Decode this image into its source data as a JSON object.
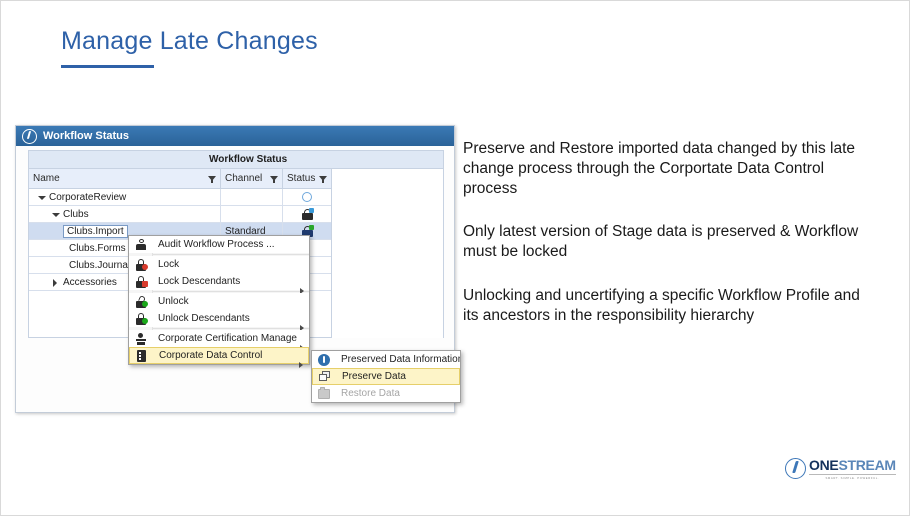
{
  "slide": {
    "title": "Manage Late Changes"
  },
  "app": {
    "titlebar": {
      "icon": "onestream-circle-icon",
      "text": "Workflow Status"
    },
    "grid": {
      "group_header": "Workflow Status",
      "columns": [
        {
          "label": "Name",
          "filter_icon": "filter-funnel-icon"
        },
        {
          "label": "Channel",
          "filter_icon": "filter-funnel-icon"
        },
        {
          "label": "Status",
          "filter_icon": "filter-funnel-icon"
        }
      ],
      "rows": [
        {
          "name": "CorporateReview",
          "indent": 0,
          "expander": "down",
          "channel": "",
          "status_icon": "circle-empty-icon",
          "selected": false
        },
        {
          "name": "Clubs",
          "indent": 1,
          "expander": "down",
          "channel": "",
          "status_icon": "lock-blue-icon",
          "selected": false
        },
        {
          "name": "Clubs.Import",
          "indent": 2,
          "expander": "none",
          "channel": "Standard",
          "status_icon": "lock-green-icon",
          "selected": true
        },
        {
          "name": "Clubs.Forms",
          "indent": 2,
          "expander": "none",
          "channel": "",
          "status_icon": "",
          "selected": false
        },
        {
          "name": "Clubs.Journals",
          "indent": 2,
          "expander": "none",
          "channel": "",
          "status_icon": "",
          "selected": false
        },
        {
          "name": "Accessories",
          "indent": 1,
          "expander": "right",
          "channel": "",
          "status_icon": "",
          "selected": false
        }
      ]
    },
    "context_menu": {
      "items": [
        {
          "label": "Audit Workflow Process ...",
          "icon": "audit-icon",
          "submenu": false,
          "disabled": false,
          "highlight": false,
          "separator_after": true
        },
        {
          "label": "Lock",
          "icon": "lock-red-icon",
          "submenu": false,
          "disabled": false,
          "highlight": false,
          "separator_after": false
        },
        {
          "label": "Lock Descendants",
          "icon": "lock-red-plus-icon",
          "submenu": true,
          "disabled": false,
          "highlight": false,
          "separator_after": true
        },
        {
          "label": "Unlock",
          "icon": "unlock-green-icon",
          "submenu": false,
          "disabled": false,
          "highlight": false,
          "separator_after": false
        },
        {
          "label": "Unlock Descendants",
          "icon": "unlock-green-descendants-icon",
          "submenu": true,
          "disabled": false,
          "highlight": false,
          "separator_after": true
        },
        {
          "label": "Corporate Certification Management",
          "icon": "certification-icon",
          "submenu": true,
          "disabled": false,
          "highlight": false,
          "separator_after": false
        },
        {
          "label": "Corporate Data Control",
          "icon": "data-control-icon",
          "submenu": true,
          "disabled": false,
          "highlight": true,
          "separator_after": false
        }
      ]
    },
    "submenu": {
      "items": [
        {
          "label": "Preserved Data Information",
          "icon": "info-icon",
          "disabled": false,
          "highlight": false
        },
        {
          "label": "Preserve Data",
          "icon": "copy-icon",
          "disabled": false,
          "highlight": true
        },
        {
          "label": "Restore Data",
          "icon": "restore-folder-icon",
          "disabled": true,
          "highlight": false
        }
      ]
    }
  },
  "bullets": [
    "Preserve and Restore imported data changed by this late change process through the Corportate Data Control process",
    "Only latest version of Stage data is preserved & Workflow must be locked",
    "Unlocking and uncertifying a specific Workflow Profile and its ancestors in the responsibility hierarchy"
  ],
  "logo": {
    "one": "ONE",
    "stream": "STREAM",
    "tagline": "SMART. SIMPLE. POWERFUL."
  },
  "colors": {
    "title_blue": "#2e61a8",
    "titlebar_blue": "#2e6ca8",
    "selection_blue": "#cfdcf0",
    "highlight_yellow": "#fdf4c8",
    "logo_navy": "#15325c",
    "logo_blue": "#5a86b8"
  }
}
